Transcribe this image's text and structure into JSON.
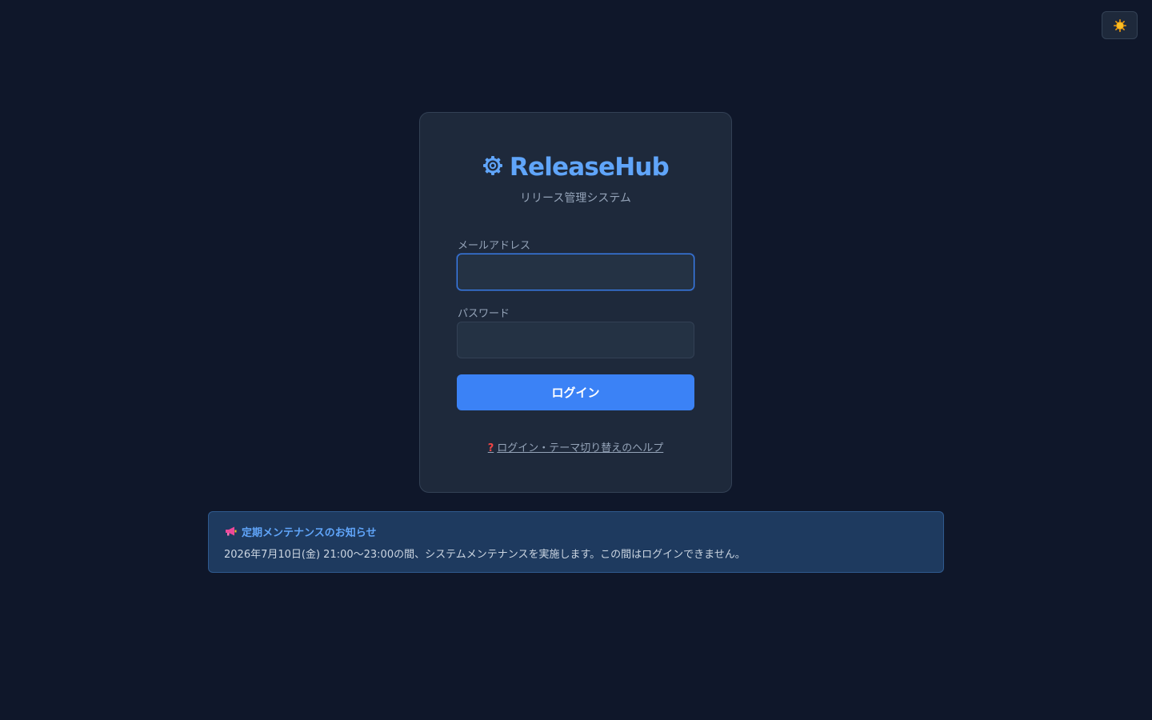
{
  "theme_toggle": {
    "icon": "sun-icon"
  },
  "login_card": {
    "brand": {
      "icon": "gear-icon",
      "title": "ReleaseHub",
      "color": "#60a5fa"
    },
    "subtitle": "リリース管理システム",
    "email": {
      "label": "メールアドレス",
      "value": "",
      "placeholder": ""
    },
    "password": {
      "label": "パスワード",
      "value": "",
      "placeholder": ""
    },
    "login_button": {
      "label": "ログイン",
      "color": "#3b82f6"
    },
    "help_link": {
      "icon": "question-icon",
      "label": "ログイン・テーマ切り替えのヘルプ"
    }
  },
  "notice": {
    "icon": "megaphone-icon",
    "title": "定期メンテナンスのお知らせ",
    "body": "2026年7月10日(金) 21:00〜23:00の間、システムメンテナンスを実施します。この間はログインできません。"
  },
  "colors": {
    "background": "#0f172a",
    "card": "#1e293b",
    "notice_background": "#1e3a5f",
    "accent": "#60a5fa"
  }
}
